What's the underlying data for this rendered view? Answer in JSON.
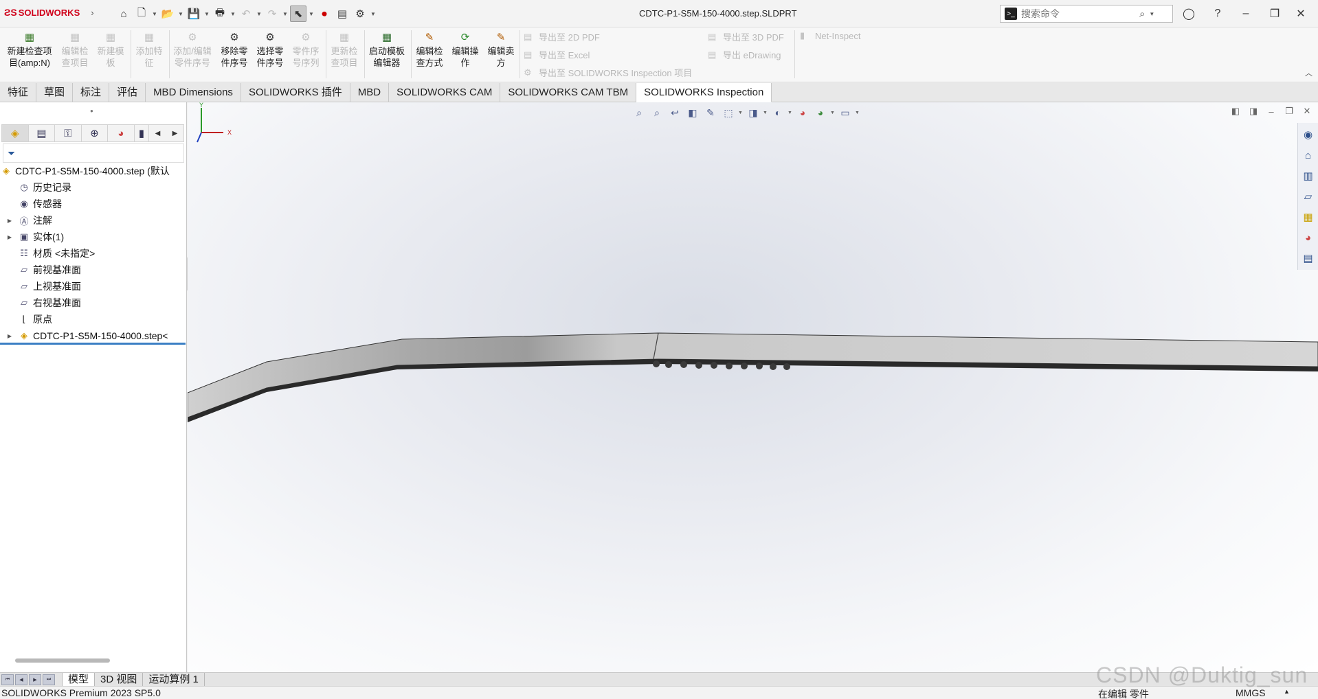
{
  "app": {
    "logo_text": "SOLIDWORKS",
    "document_title": "CDTC-P1-S5M-150-4000.step.SLDPRT"
  },
  "search": {
    "placeholder": "搜索命令"
  },
  "ribbon": {
    "buttons": [
      {
        "label": "新建检查项\n目(amp:N)",
        "enabled": true,
        "icon": "new-inspection-icon"
      },
      {
        "label": "编辑检\n查项目",
        "enabled": false,
        "icon": "edit-inspection-icon"
      },
      {
        "label": "新建模\n板",
        "enabled": false,
        "icon": "new-template-icon"
      },
      {
        "label": "添加特\n征",
        "enabled": false,
        "icon": "add-feature-icon"
      },
      {
        "label": "添加/编辑\n零件序号",
        "enabled": false,
        "icon": "balloon-icon"
      },
      {
        "label": "移除零\n件序号",
        "enabled": true,
        "icon": "remove-balloon-icon"
      },
      {
        "label": "选择零\n件序号",
        "enabled": true,
        "icon": "select-balloon-icon"
      },
      {
        "label": "零件序\n号序列",
        "enabled": false,
        "icon": "balloon-sequence-icon"
      },
      {
        "label": "更新检\n查项目",
        "enabled": false,
        "icon": "update-inspection-icon"
      },
      {
        "label": "启动模板\n编辑器",
        "enabled": true,
        "icon": "template-editor-icon"
      },
      {
        "label": "编辑检\n查方式",
        "enabled": true,
        "icon": "edit-method-icon"
      },
      {
        "label": "编辑操\n作",
        "enabled": true,
        "icon": "edit-operation-icon"
      },
      {
        "label": "编辑卖\n方",
        "enabled": true,
        "icon": "edit-vendor-icon"
      }
    ],
    "export_2d_pdf": "导出至 2D PDF",
    "export_excel": "导出至 Excel",
    "export_inspection": "导出至 SOLIDWORKS Inspection 项目",
    "export_3d_pdf": "导出至 3D PDF",
    "export_edrawing": "导出 eDrawing",
    "net_inspect": "Net-Inspect"
  },
  "tabs": [
    {
      "label": "特征",
      "active": false
    },
    {
      "label": "草图",
      "active": false
    },
    {
      "label": "标注",
      "active": false
    },
    {
      "label": "评估",
      "active": false
    },
    {
      "label": "MBD Dimensions",
      "active": false
    },
    {
      "label": "SOLIDWORKS 插件",
      "active": false
    },
    {
      "label": "MBD",
      "active": false
    },
    {
      "label": "SOLIDWORKS CAM",
      "active": false
    },
    {
      "label": "SOLIDWORKS CAM TBM",
      "active": false
    },
    {
      "label": "SOLIDWORKS Inspection",
      "active": true
    }
  ],
  "tree": [
    {
      "label": "CDTC-P1-S5M-150-4000.step (默认",
      "icon": "part-icon",
      "expandable": false,
      "indent": 0
    },
    {
      "label": "历史记录",
      "icon": "history-icon",
      "expandable": false,
      "indent": 1
    },
    {
      "label": "传感器",
      "icon": "sensor-icon",
      "expandable": false,
      "indent": 1
    },
    {
      "label": "注解",
      "icon": "annotation-icon",
      "expandable": true,
      "indent": 1
    },
    {
      "label": "实体(1)",
      "icon": "solid-body-icon",
      "expandable": true,
      "indent": 1
    },
    {
      "label": "材质 <未指定>",
      "icon": "material-icon",
      "expandable": false,
      "indent": 1
    },
    {
      "label": "前视基准面",
      "icon": "plane-icon",
      "expandable": false,
      "indent": 1
    },
    {
      "label": "上视基准面",
      "icon": "plane-icon",
      "expandable": false,
      "indent": 1
    },
    {
      "label": "右视基准面",
      "icon": "plane-icon",
      "expandable": false,
      "indent": 1
    },
    {
      "label": "原点",
      "icon": "origin-icon",
      "expandable": false,
      "indent": 1
    },
    {
      "label": "CDTC-P1-S5M-150-4000.step<",
      "icon": "imported-part-icon",
      "expandable": true,
      "indent": 1
    }
  ],
  "bottom_tabs": [
    {
      "label": "模型",
      "active": true
    },
    {
      "label": "3D 视图",
      "active": false
    },
    {
      "label": "运动算例 1",
      "active": false
    }
  ],
  "triad": {
    "x_label": "X",
    "y_label": "Y"
  },
  "status": {
    "product": "SOLIDWORKS Premium 2023 SP5.0",
    "mode": "在编辑 零件",
    "units": "MMGS"
  },
  "watermark": "CSDN @Duktig_sun",
  "colors": {
    "accent": "#3b7fc4",
    "brand": "#d0021b"
  }
}
